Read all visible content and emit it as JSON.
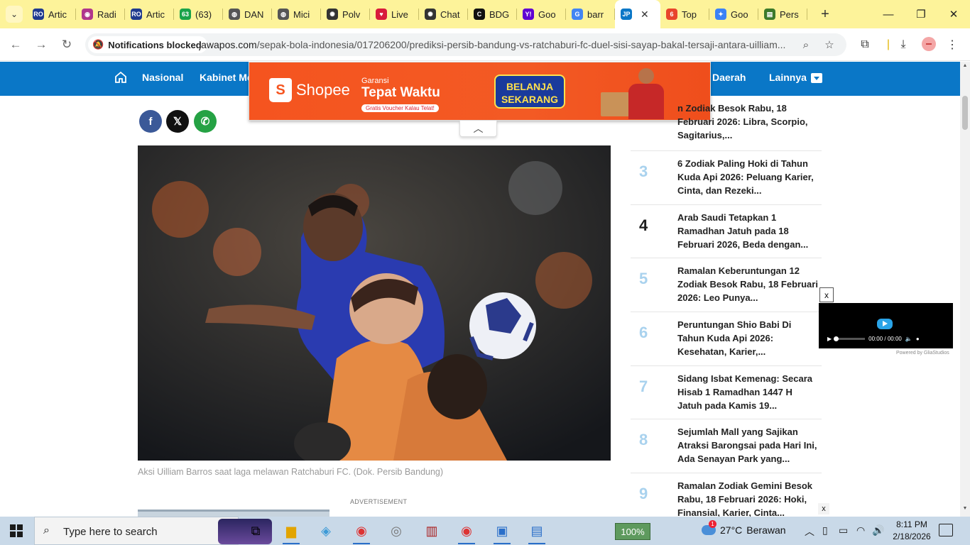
{
  "browser": {
    "tabs": [
      {
        "label": "Artic",
        "icon": "rd-icon",
        "color": "#1f3a8f",
        "glyph": "RO"
      },
      {
        "label": "Radi",
        "icon": "radio-icon",
        "color": "#b0368c",
        "glyph": "◉"
      },
      {
        "label": "Artic",
        "icon": "rd-icon",
        "color": "#1f3a8f",
        "glyph": "RO"
      },
      {
        "label": "(63)",
        "icon": "whatsapp-icon",
        "color": "#1aa34a",
        "glyph": "63"
      },
      {
        "label": "DAN",
        "icon": "globe-icon",
        "color": "#555555",
        "glyph": "◍"
      },
      {
        "label": "Mici",
        "icon": "globe-icon",
        "color": "#555555",
        "glyph": "◍"
      },
      {
        "label": "Polv",
        "icon": "chatgpt-icon",
        "color": "#333333",
        "glyph": "✺"
      },
      {
        "label": "Live",
        "icon": "vidio-icon",
        "color": "#d81b3b",
        "glyph": "♥"
      },
      {
        "label": "Chat",
        "icon": "chatgpt-icon",
        "color": "#333333",
        "glyph": "✺"
      },
      {
        "label": "BDG",
        "icon": "capcut-icon",
        "color": "#111111",
        "glyph": "C"
      },
      {
        "label": "Goo",
        "icon": "yahoo-icon",
        "color": "#6001d2",
        "glyph": "Y!"
      },
      {
        "label": "barr",
        "icon": "google-icon",
        "color": "#4285f4",
        "glyph": "G"
      },
      {
        "label": "",
        "icon": "jawapos-icon",
        "color": "#0a77c7",
        "glyph": "JP",
        "active": true
      },
      {
        "label": "Top",
        "icon": "six-icon",
        "color": "#e8452c",
        "glyph": "6"
      },
      {
        "label": "Goo",
        "icon": "gemini-icon",
        "color": "#3b82f6",
        "glyph": "✦"
      },
      {
        "label": "Pers",
        "icon": "persib-icon",
        "color": "#3b7a2a",
        "glyph": "▤"
      }
    ],
    "new_tab": "+",
    "notification_chip": "Notifications blocked",
    "url_domain": "jawapos.com",
    "url_path": "/sepak-bola-indonesia/017206200/prediksi-persib-bandung-vs-ratchaburi-fc-duel-sisi-sayap-bakal-tersaji-antara-uilliam..."
  },
  "site": {
    "nav": [
      "Nasional",
      "Kabinet Me",
      "Daerah",
      "Lainnya"
    ],
    "ad": {
      "brand": "Shopee",
      "line1": "Garansi",
      "line2": "Tepat Waktu",
      "line3": "Gratis Voucher Kalau Telat!",
      "cta": "BELANJA SEKARANG"
    },
    "share": [
      {
        "name": "facebook",
        "glyph": "f",
        "color": "#3b5998"
      },
      {
        "name": "x",
        "glyph": "𝕏",
        "color": "#111111"
      },
      {
        "name": "whatsapp",
        "glyph": "✆",
        "color": "#25a244"
      }
    ],
    "caption": "Aksi Uilliam Barros saat laga melawan Ratchaburi FC. (Dok. Persib Bandung)",
    "advertisement_label": "ADVERTISEMENT",
    "trending": [
      {
        "num": "",
        "title": "n Zodiak Besok Rabu, 18 Februari 2026: Libra, Scorpio, Sagitarius,..."
      },
      {
        "num": "3",
        "title": "6 Zodiak Paling Hoki di Tahun Kuda Api 2026: Peluang Karier, Cinta, dan Rezeki..."
      },
      {
        "num": "4",
        "title": "Arab Saudi Tetapkan 1 Ramadhan Jatuh pada 18 Februari 2026, Beda dengan...",
        "dark": true
      },
      {
        "num": "5",
        "title": "Ramalan Keberuntungan 12 Zodiak Besok Rabu, 18 Februari 2026: Leo Punya..."
      },
      {
        "num": "6",
        "title": "Peruntungan Shio Babi Di Tahun Kuda Api 2026: Kesehatan, Karier,..."
      },
      {
        "num": "7",
        "title": "Sidang Isbat Kemenag: Secara Hisab 1 Ramadhan 1447 H Jatuh pada Kamis 19..."
      },
      {
        "num": "8",
        "title": "Sejumlah Mall yang Sajikan Atraksi Barongsai pada Hari Ini, Ada Senayan Park yang..."
      },
      {
        "num": "9",
        "title": "Ramalan Zodiak Gemini Besok Rabu, 18 Februari 2026: Hoki, Finansial, Karier, Cinta..."
      }
    ],
    "video": {
      "close": "x",
      "time": "00:00 / 00:00",
      "powered": "Powered by GliaStudios"
    },
    "small_close": "x"
  },
  "taskbar": {
    "search_placeholder": "Type here to search",
    "zoom": "100%",
    "weather_temp": "27°C",
    "weather_desc": "Berawan",
    "weather_badge": "1",
    "time": "8:11 PM",
    "date": "2/18/2026"
  }
}
